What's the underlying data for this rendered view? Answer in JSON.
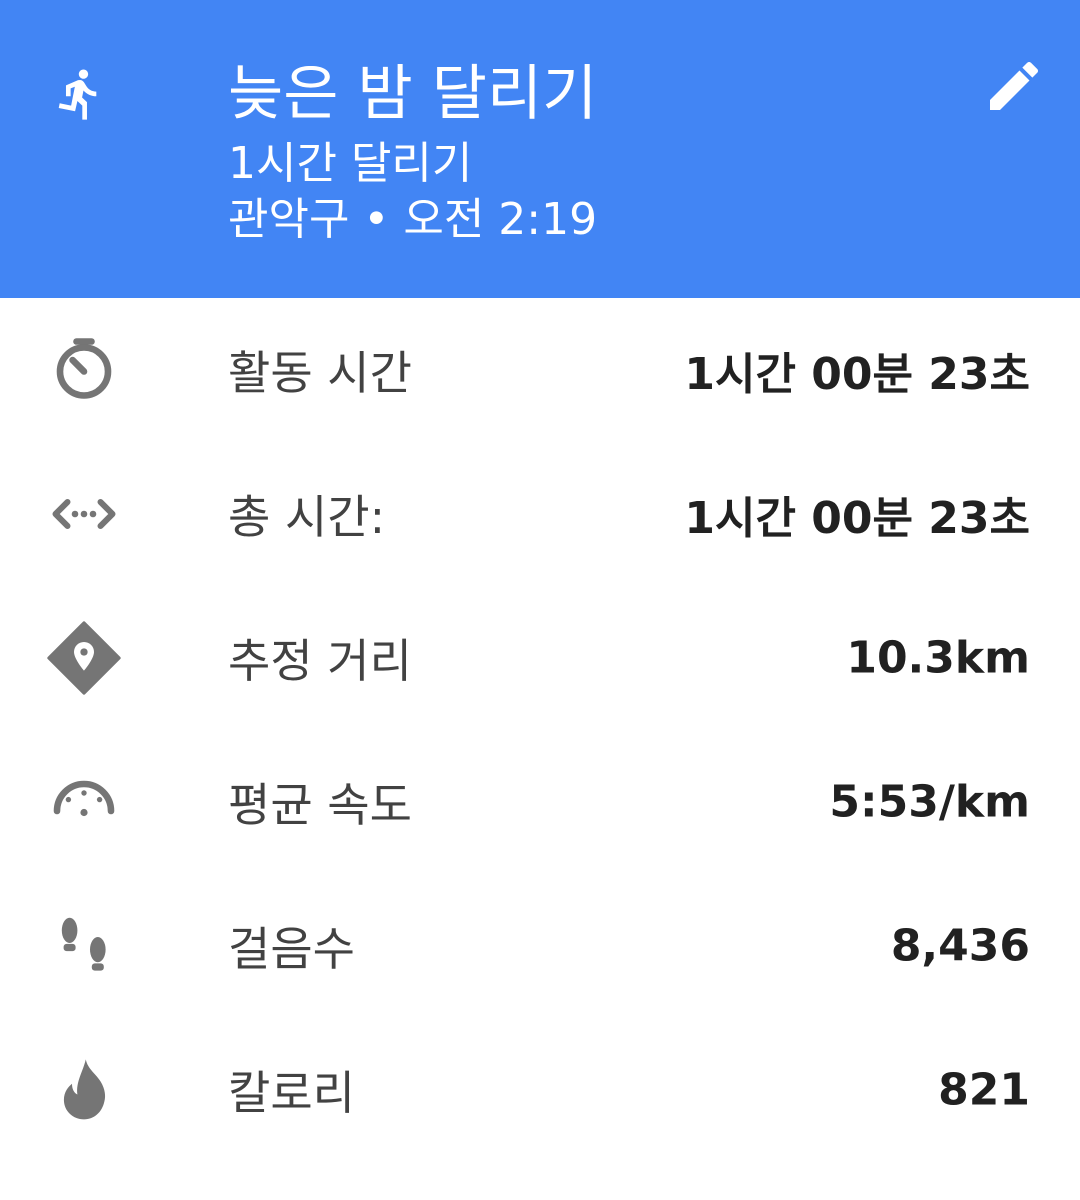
{
  "header": {
    "title": "늦은 밤 달리기",
    "subtitle": "1시간 달리기",
    "meta": "관악구 • 오전 2:19",
    "background_color": "#4285f4",
    "left_icon": "running-icon",
    "right_icon": "pencil-icon"
  },
  "stats": [
    {
      "icon": "timer-icon",
      "label": "활동 시간",
      "value": "1시간 00분 23초"
    },
    {
      "icon": "code-arrows-icon",
      "label": "총 시간:",
      "value": "1시간 00분 23초"
    },
    {
      "icon": "directions-diamond-pin-icon",
      "label": "추정 거리",
      "value": "10.3km"
    },
    {
      "icon": "speedometer-icon",
      "label": "평균 속도",
      "value": "5:53/km"
    },
    {
      "icon": "footsteps-icon",
      "label": "걸음수",
      "value": "8,436"
    },
    {
      "icon": "flame-icon",
      "label": "칼로리",
      "value": "821"
    }
  ],
  "colors": {
    "icon_gray": "#757575",
    "label_gray": "#424242",
    "value_dark": "#212121"
  }
}
